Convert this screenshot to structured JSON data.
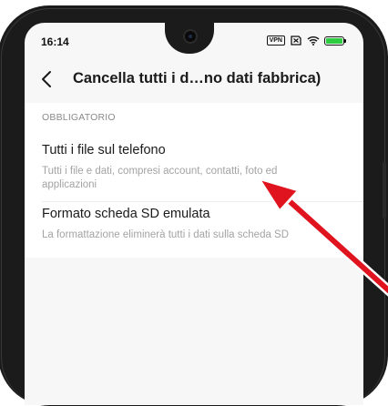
{
  "status_bar": {
    "time": "16:14",
    "vpn_label": "VPN",
    "battery_level": 1.0,
    "battery_color": "#2ecc40"
  },
  "toolbar": {
    "title": "Cancella tutti i d…no dati fabbrica)"
  },
  "section": {
    "header": "OBBLIGATORIO",
    "items": [
      {
        "title": "Tutti i file sul telefono",
        "description": "Tutti i file e dati, compresi account, contatti, foto ed applicazioni"
      },
      {
        "title": "Formato scheda SD emulata",
        "description": "La formattazione eliminerà tutti i dati sulla scheda SD"
      }
    ]
  },
  "annotation": {
    "arrow_color": "#e0141e"
  }
}
